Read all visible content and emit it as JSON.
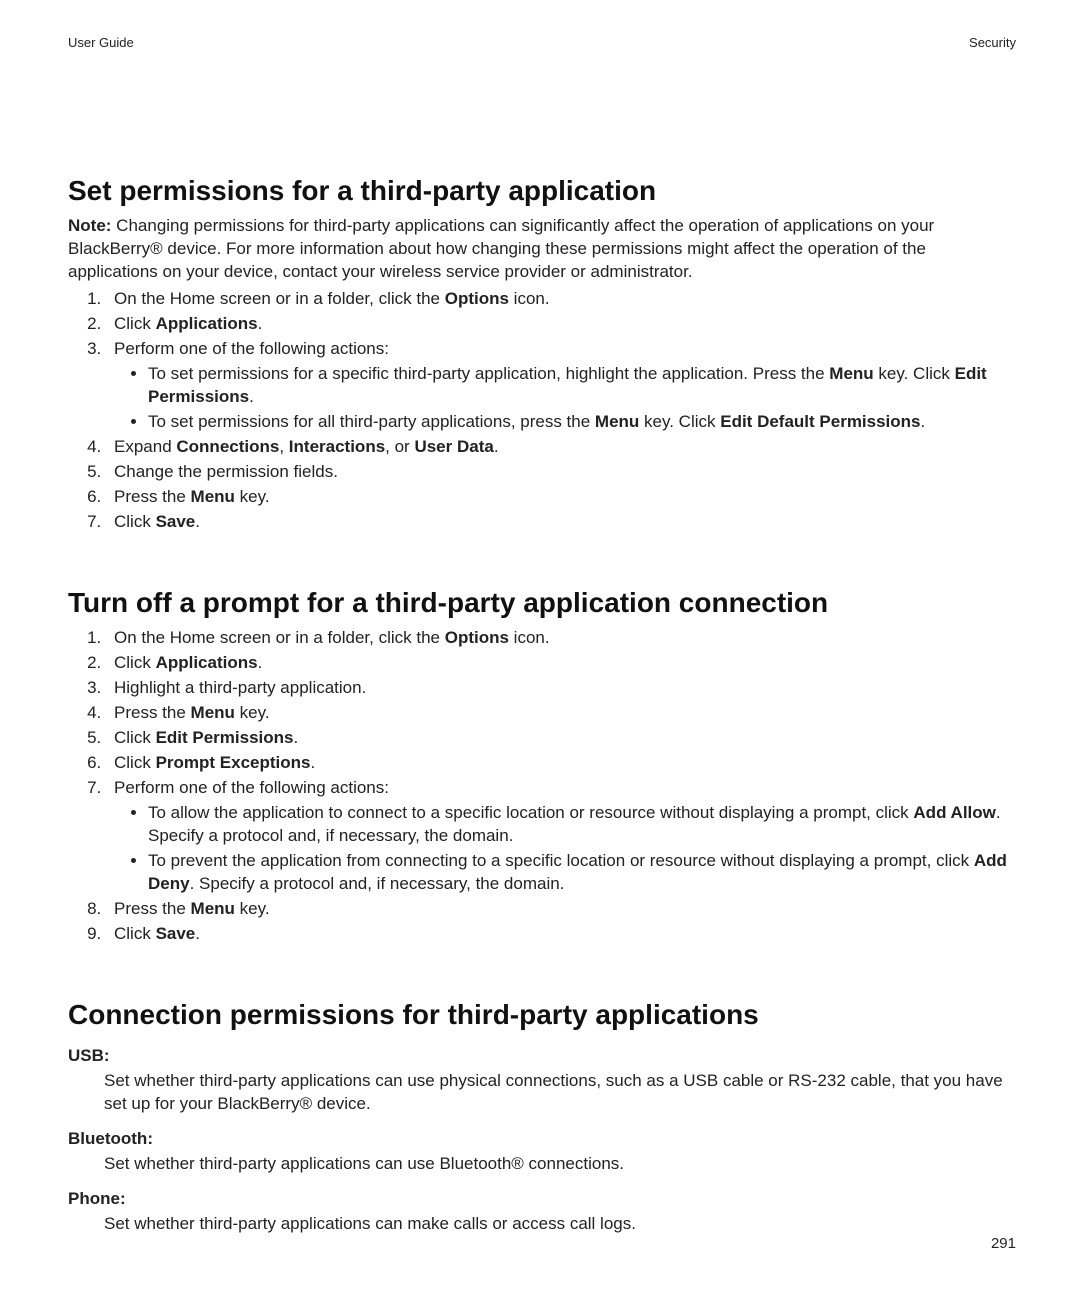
{
  "header": {
    "left": "User Guide",
    "right": "Security"
  },
  "pageNumber": "291",
  "sec1": {
    "title": "Set permissions for a third-party application",
    "note_label": "Note:",
    "note_body": "  Changing permissions for third-party applications can significantly affect the operation of applications on your BlackBerry® device. For more information about how changing these permissions might affect the operation of the applications on your device, contact your wireless service provider or administrator.",
    "s1a": "On the Home screen or in a folder, click the ",
    "s1b": "Options",
    "s1c": " icon.",
    "s2a": "Click ",
    "s2b": "Applications",
    "s2c": ".",
    "s3": "Perform one of the following actions:",
    "s3b1a": "To set permissions for a specific third-party application, highlight the application. Press the ",
    "s3b1b": "Menu",
    "s3b1c": " key. Click ",
    "s3b1d": "Edit Permissions",
    "s3b1e": ".",
    "s3b2a": "To set permissions for all third-party applications, press the ",
    "s3b2b": "Menu",
    "s3b2c": " key. Click ",
    "s3b2d": "Edit Default Permissions",
    "s3b2e": ".",
    "s4a": "Expand ",
    "s4b": "Connections",
    "s4c": ", ",
    "s4d": "Interactions",
    "s4e": ", or ",
    "s4f": "User Data",
    "s4g": ".",
    "s5": "Change the permission fields.",
    "s6a": "Press the ",
    "s6b": "Menu",
    "s6c": " key.",
    "s7a": "Click ",
    "s7b": "Save",
    "s7c": "."
  },
  "sec2": {
    "title": "Turn off a prompt for a third-party application connection",
    "s1a": "On the Home screen or in a folder, click the ",
    "s1b": "Options",
    "s1c": " icon.",
    "s2a": "Click ",
    "s2b": "Applications",
    "s2c": ".",
    "s3": "Highlight a third-party application.",
    "s4a": "Press the ",
    "s4b": "Menu",
    "s4c": " key.",
    "s5a": "Click ",
    "s5b": "Edit Permissions",
    "s5c": ".",
    "s6a": "Click ",
    "s6b": "Prompt Exceptions",
    "s6c": ".",
    "s7": "Perform one of the following actions:",
    "s7b1a": "To allow the application to connect to a specific location or resource without displaying a prompt, click ",
    "s7b1b": "Add Allow",
    "s7b1c": ". Specify a protocol and, if necessary, the domain.",
    "s7b2a": "To prevent the application from connecting to a specific location or resource without displaying a prompt, click ",
    "s7b2b": "Add Deny",
    "s7b2c": ". Specify a protocol and, if necessary, the domain.",
    "s8a": "Press the ",
    "s8b": "Menu",
    "s8c": " key.",
    "s9a": "Click ",
    "s9b": "Save",
    "s9c": "."
  },
  "sec3": {
    "title": "Connection permissions for third-party applications",
    "usb_t": "USB:",
    "usb_d": "Set whether third-party applications can use physical connections, such as a USB cable or RS-232 cable, that you have set up for your BlackBerry® device.",
    "bt_t": "Bluetooth:",
    "bt_d": "Set whether third-party applications can use Bluetooth® connections.",
    "ph_t": "Phone:",
    "ph_d": "Set whether third-party applications can make calls or access call logs."
  }
}
